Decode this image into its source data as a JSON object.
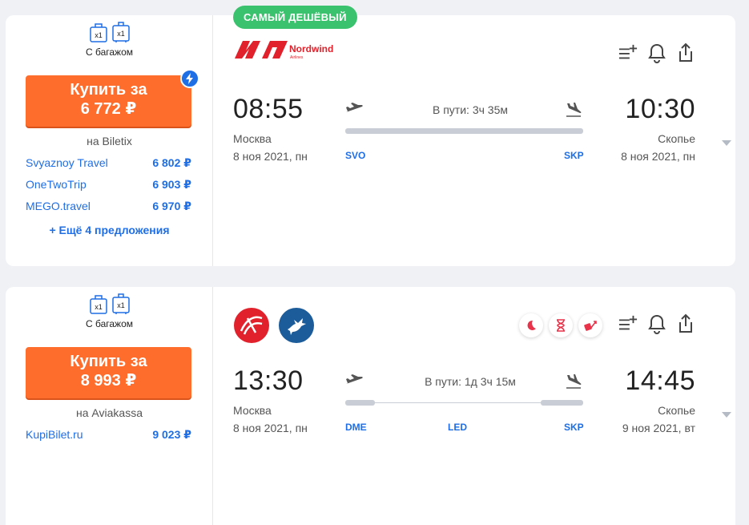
{
  "tickets": [
    {
      "baggage_label": "С багажом",
      "bag_counts": [
        "x1",
        "x1"
      ],
      "buy_line1": "Купить за",
      "buy_price": "6 772 ₽",
      "agency": "на Biletix",
      "offers": [
        {
          "name": "Svyaznoy Travel",
          "price": "6 802 ₽"
        },
        {
          "name": "OneTwoTrip",
          "price": "6 903 ₽"
        },
        {
          "name": "MEGO.travel",
          "price": "6 970 ₽"
        }
      ],
      "more_offers": "+ Ещё 4 предложения",
      "badge": "САМЫЙ ДЕШЁВЫЙ",
      "airline_logo": {
        "name": "Nordwind",
        "sub": "Airlines",
        "color": "#e1212b"
      },
      "departure": {
        "time": "08:55",
        "city": "Москва",
        "date": "8 ноя 2021, пн",
        "iata": "SVO"
      },
      "arrival": {
        "time": "10:30",
        "city": "Скопье",
        "date": "8 ноя 2021, пн",
        "iata": "SKP"
      },
      "duration": "В пути: 3ч 35м"
    },
    {
      "baggage_label": "С багажом",
      "bag_counts": [
        "x1",
        "x1"
      ],
      "buy_line1": "Купить за",
      "buy_price": "8 993 ₽",
      "agency": "на Aviakassa",
      "offers": [
        {
          "name": "KupiBilet.ru",
          "price": "9 023 ₽"
        }
      ],
      "departure": {
        "time": "13:30",
        "city": "Москва",
        "date": "8 ноя 2021, пн",
        "iata": "DME"
      },
      "stop": {
        "iata": "LED"
      },
      "arrival": {
        "time": "14:45",
        "city": "Скопье",
        "date": "9 ноя 2021, вт",
        "iata": "SKP"
      },
      "duration": "В пути: 1д 3ч 15м",
      "flags": [
        "night-flight-icon",
        "long-layover-icon",
        "baggage-recheck-icon"
      ]
    }
  ],
  "colors": {
    "accent": "#1e6ee6",
    "buy": "#ff6d2c",
    "badge": "#3bc26e",
    "warn": "#e8334a"
  }
}
